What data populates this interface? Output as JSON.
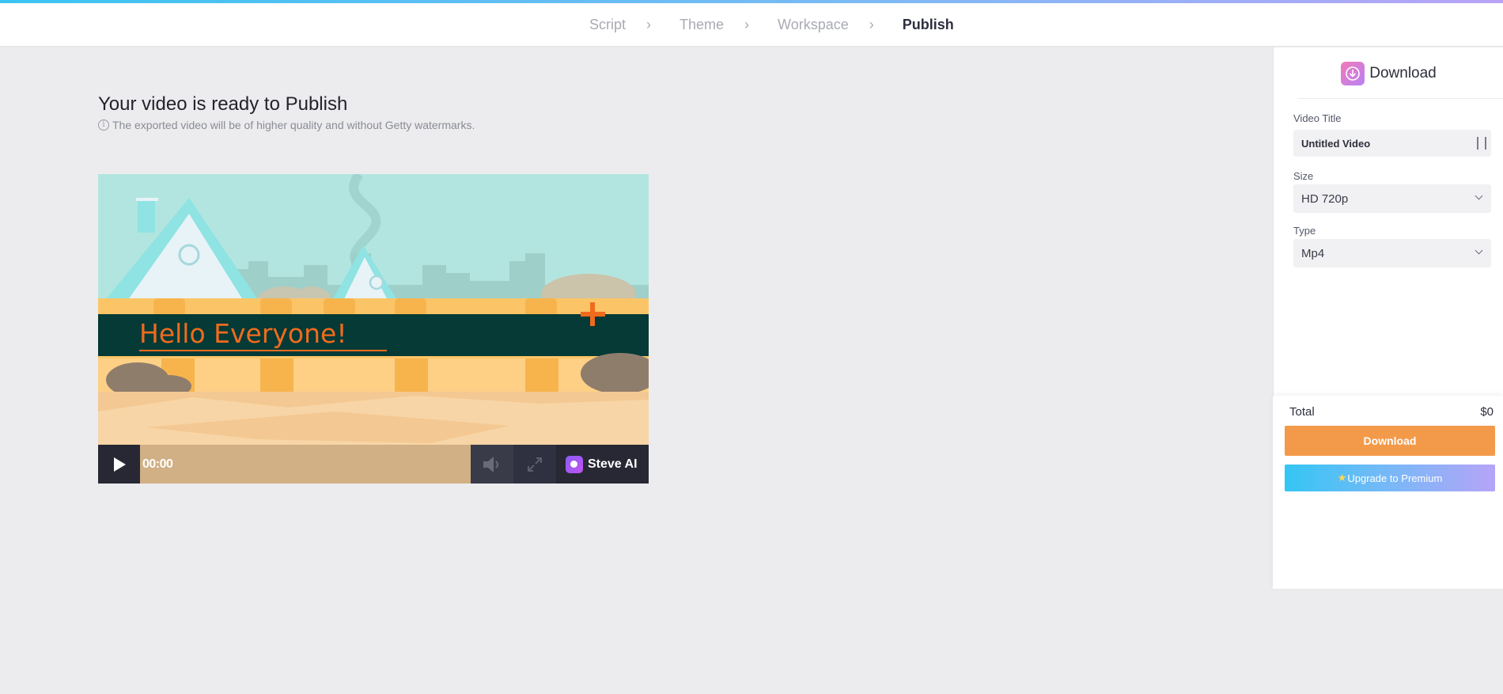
{
  "steps": {
    "script": "Script",
    "theme": "Theme",
    "workspace": "Workspace",
    "publish": "Publish",
    "active": "Publish"
  },
  "main": {
    "headline": "Your video is ready to Publish",
    "notice": "The exported video will be of higher quality and without Getty watermarks."
  },
  "player": {
    "caption": "Hello Everyone!",
    "time": "00:00",
    "brand": "Steve AI"
  },
  "panel": {
    "title": "Download",
    "video_title_label": "Video Title",
    "video_title_value": "Untitled Video",
    "size_label": "Size",
    "size_value": "HD 720p",
    "type_label": "Type",
    "type_value": "Mp4"
  },
  "checkout": {
    "total_label": "Total",
    "total_value": "$0",
    "download_label": "Download",
    "premium_label": "Upgrade to Premium"
  },
  "colors": {
    "accent_orange": "#f39a4a",
    "caption_band": "#053a36",
    "caption_text": "#f06b1d"
  }
}
